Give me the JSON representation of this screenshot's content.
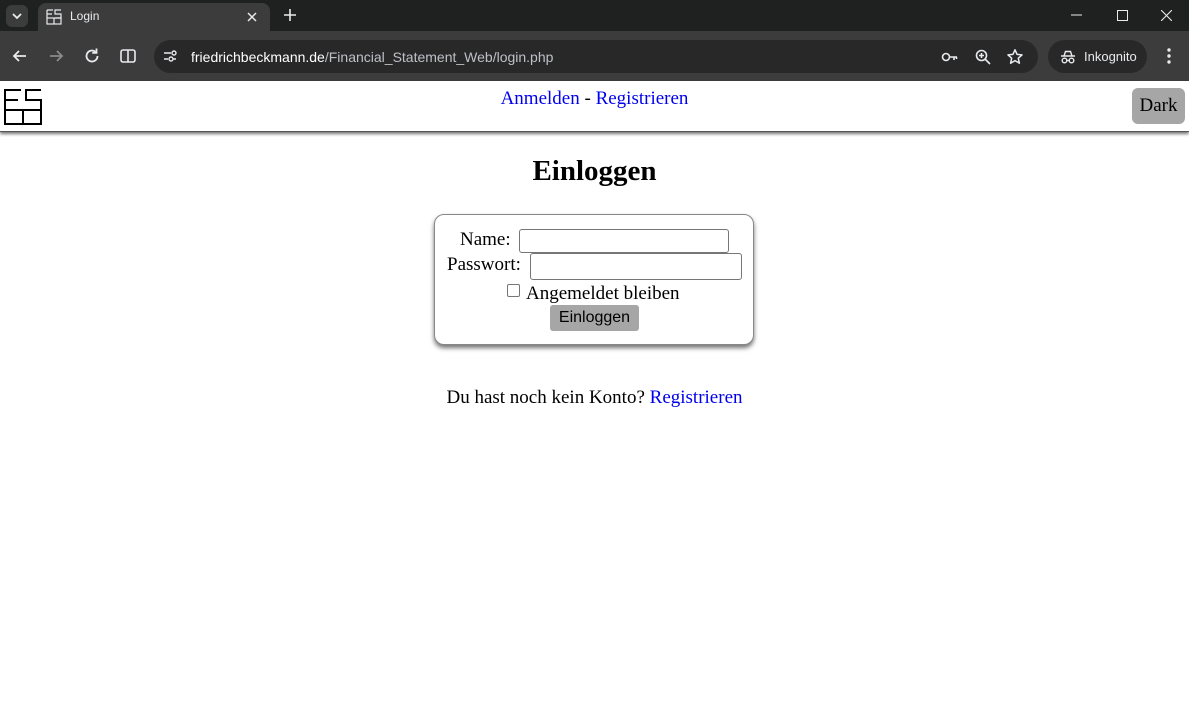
{
  "browser": {
    "tab_title": "Login",
    "url_host": "friedrichbeckmann.de",
    "url_path": "/Financial_Statement_Web/login.php",
    "incognito_label": "Inkognito",
    "theme": {
      "tabbar_bg": "#1f2020",
      "toolbar_bg": "#3c3c3c",
      "omnibox_bg": "#282828"
    }
  },
  "header": {
    "login_link": "Anmelden",
    "separator": "-",
    "register_link": "Registrieren",
    "dark_button": "Dark"
  },
  "main": {
    "title": "Einloggen",
    "form": {
      "name_label": "Name:",
      "name_value": "",
      "password_label": "Passwort:",
      "password_value": "",
      "remember_label": "Angemeldet bleiben",
      "remember_checked": false,
      "submit_label": "Einloggen"
    },
    "register_prompt": "Du hast noch kein Konto?",
    "register_link": "Registrieren"
  },
  "colors": {
    "link": "#0000ee",
    "button_bg": "#a6a6a6"
  }
}
